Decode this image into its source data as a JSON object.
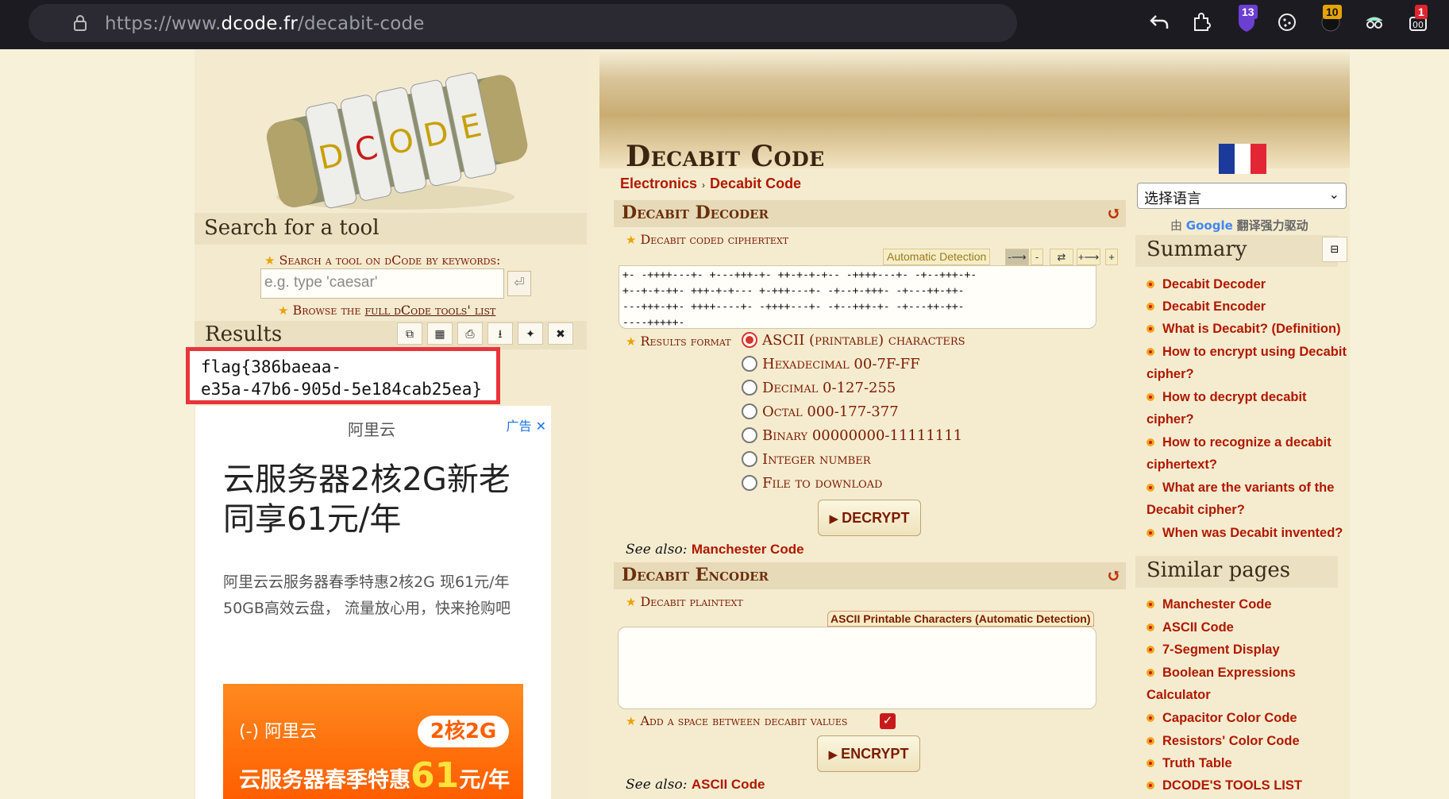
{
  "browser": {
    "url_prefix": "https://www.",
    "url_domain": "dcode.fr",
    "url_path": "/decabit-code",
    "badges": [
      "13",
      "10",
      "1"
    ]
  },
  "left": {
    "search_title": "Search for a tool",
    "search_label": "Search a tool on dCode by keywords:",
    "search_placeholder": "e.g. type 'caesar'",
    "search_go": "⏎",
    "browse_prefix": "Browse the ",
    "browse_link": "full dCode tools' list",
    "results_title": "Results",
    "result_line1": "flag{386baeaa-",
    "result_line2": "e35a-47b6-905d-5e184cab25ea}"
  },
  "ad": {
    "brand": "阿里云",
    "tag": "广告",
    "headline": "云服务器2核2G新老同享61元/年",
    "subline": "阿里云云服务器春季特惠2核2G 现61元/年 50GB高效云盘， 流量放心用，快来抢购吧",
    "banner_logo": "(-) 阿里云",
    "banner_pill": "2核2G",
    "banner_text": "云服务器春季特惠",
    "banner_price": "61",
    "banner_unit": "元/年"
  },
  "main": {
    "title": "Decabit Code",
    "crumb1": "Electronics",
    "crumb_sep": "›",
    "crumb2": "Decabit Code",
    "decoder": {
      "title": "Decabit Decoder",
      "field_label": "Decabit coded ciphertext",
      "auto_detect": "Automatic Detection",
      "cipher_lines": [
        "+- -++++---+- +---+++-+- ++-+-+-+-- -++++---+- -+--+++-+-",
        "+--+-+-++- +++-+-+--- +-+++---+- -+--+-+++- -+---++-++-",
        "---+++-++- ++++----+- -++++---+- -+--+++-+- -+---++-++-",
        "----+++++-"
      ],
      "results_format_label": "Results format",
      "options": [
        "ASCII (printable) characters",
        "Hexadecimal 00-7F-FF",
        "Decimal 0-127-255",
        "Octal 000-177-377",
        "Binary 00000000-11111111",
        "Integer number",
        "File to download"
      ],
      "button": "DECRYPT",
      "see_also_label": "See also:",
      "see_also_link": "Manchester Code"
    },
    "encoder": {
      "title": "Decabit Encoder",
      "field_label": "Decabit plaintext",
      "sub_label": "ASCII Printable Characters (Automatic Detection)",
      "space_label": "Add a space between decabit values",
      "button": "ENCRYPT",
      "see_also_label": "See also:",
      "see_also_link": "ASCII Code"
    }
  },
  "right": {
    "lang_select": "选择语言",
    "powered_prefix": "由",
    "powered_brand": "Google",
    "powered_suffix": "翻译强力驱动",
    "summary_title": "Summary",
    "summary_items": [
      "Decabit Decoder",
      "Decabit Encoder",
      "What is Decabit? (Definition)",
      "How to encrypt using Decabit cipher?",
      "How to decrypt decabit cipher?",
      "How to recognize a decabit ciphertext?",
      "What are the variants of the Decabit cipher?",
      "When was Decabit invented?"
    ],
    "similar_title": "Similar pages",
    "similar_items": [
      "Manchester Code",
      "ASCII Code",
      "7-Segment Display",
      "Boolean Expressions Calculator",
      "Capacitor Color Code",
      "Resistors' Color Code",
      "Truth Table",
      "DCODE'S TOOLS LIST"
    ]
  },
  "colors": {
    "accent": "#b01800",
    "highlight_box": "#e8353b"
  }
}
